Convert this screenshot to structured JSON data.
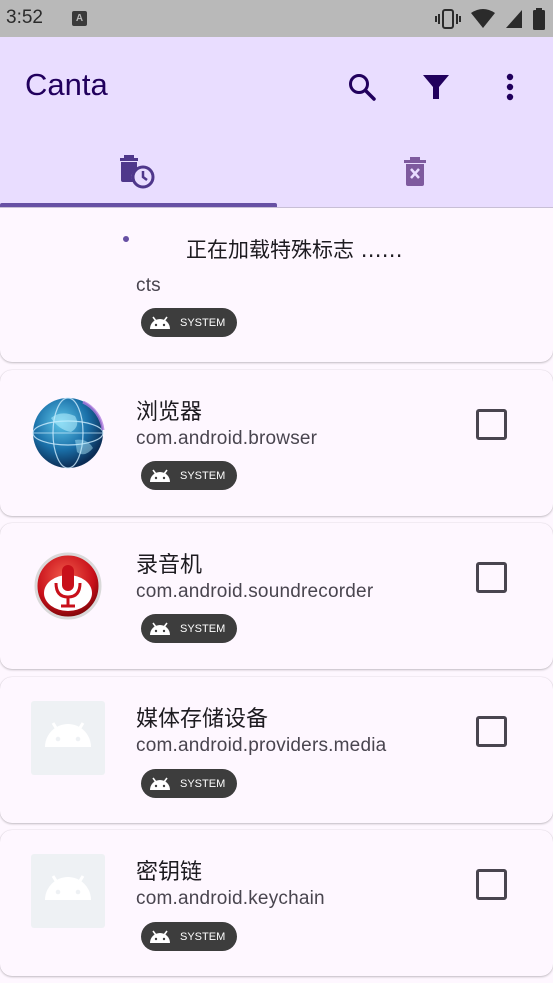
{
  "status_bar": {
    "time": "3:52",
    "notification_letter": "A"
  },
  "app_bar": {
    "title": "Canta",
    "actions": [
      "search-icon",
      "filter-icon",
      "more-vert-icon"
    ]
  },
  "tabs": [
    {
      "name": "installed-apps",
      "icon": "delete-clock-icon",
      "selected": true
    },
    {
      "name": "uninstalled-apps",
      "icon": "delete-x-icon",
      "selected": false
    }
  ],
  "loading": {
    "text": "正在加载特殊标志 ……"
  },
  "system_badge": "SYSTEM",
  "apps": [
    {
      "name": "",
      "package": "cts",
      "badge": "SYSTEM",
      "icon": "none",
      "checked": false
    },
    {
      "name": "浏览器",
      "package": "com.android.browser",
      "badge": "SYSTEM",
      "icon": "globe-icon",
      "checked": false
    },
    {
      "name": "录音机",
      "package": "com.android.soundrecorder",
      "badge": "SYSTEM",
      "icon": "microphone-icon",
      "checked": false
    },
    {
      "name": "媒体存储设备",
      "package": "com.android.providers.media",
      "badge": "SYSTEM",
      "icon": "android-icon",
      "checked": false
    },
    {
      "name": "密钥链",
      "package": "com.android.keychain",
      "badge": "SYSTEM",
      "icon": "android-icon",
      "checked": false
    }
  ],
  "colors": {
    "app_bar_bg": "#E9DDFF",
    "title": "#21005D",
    "tab_indicator": "#6750A4",
    "surface": "#FEF7FF",
    "chip_bg": "#3D3D3D"
  }
}
